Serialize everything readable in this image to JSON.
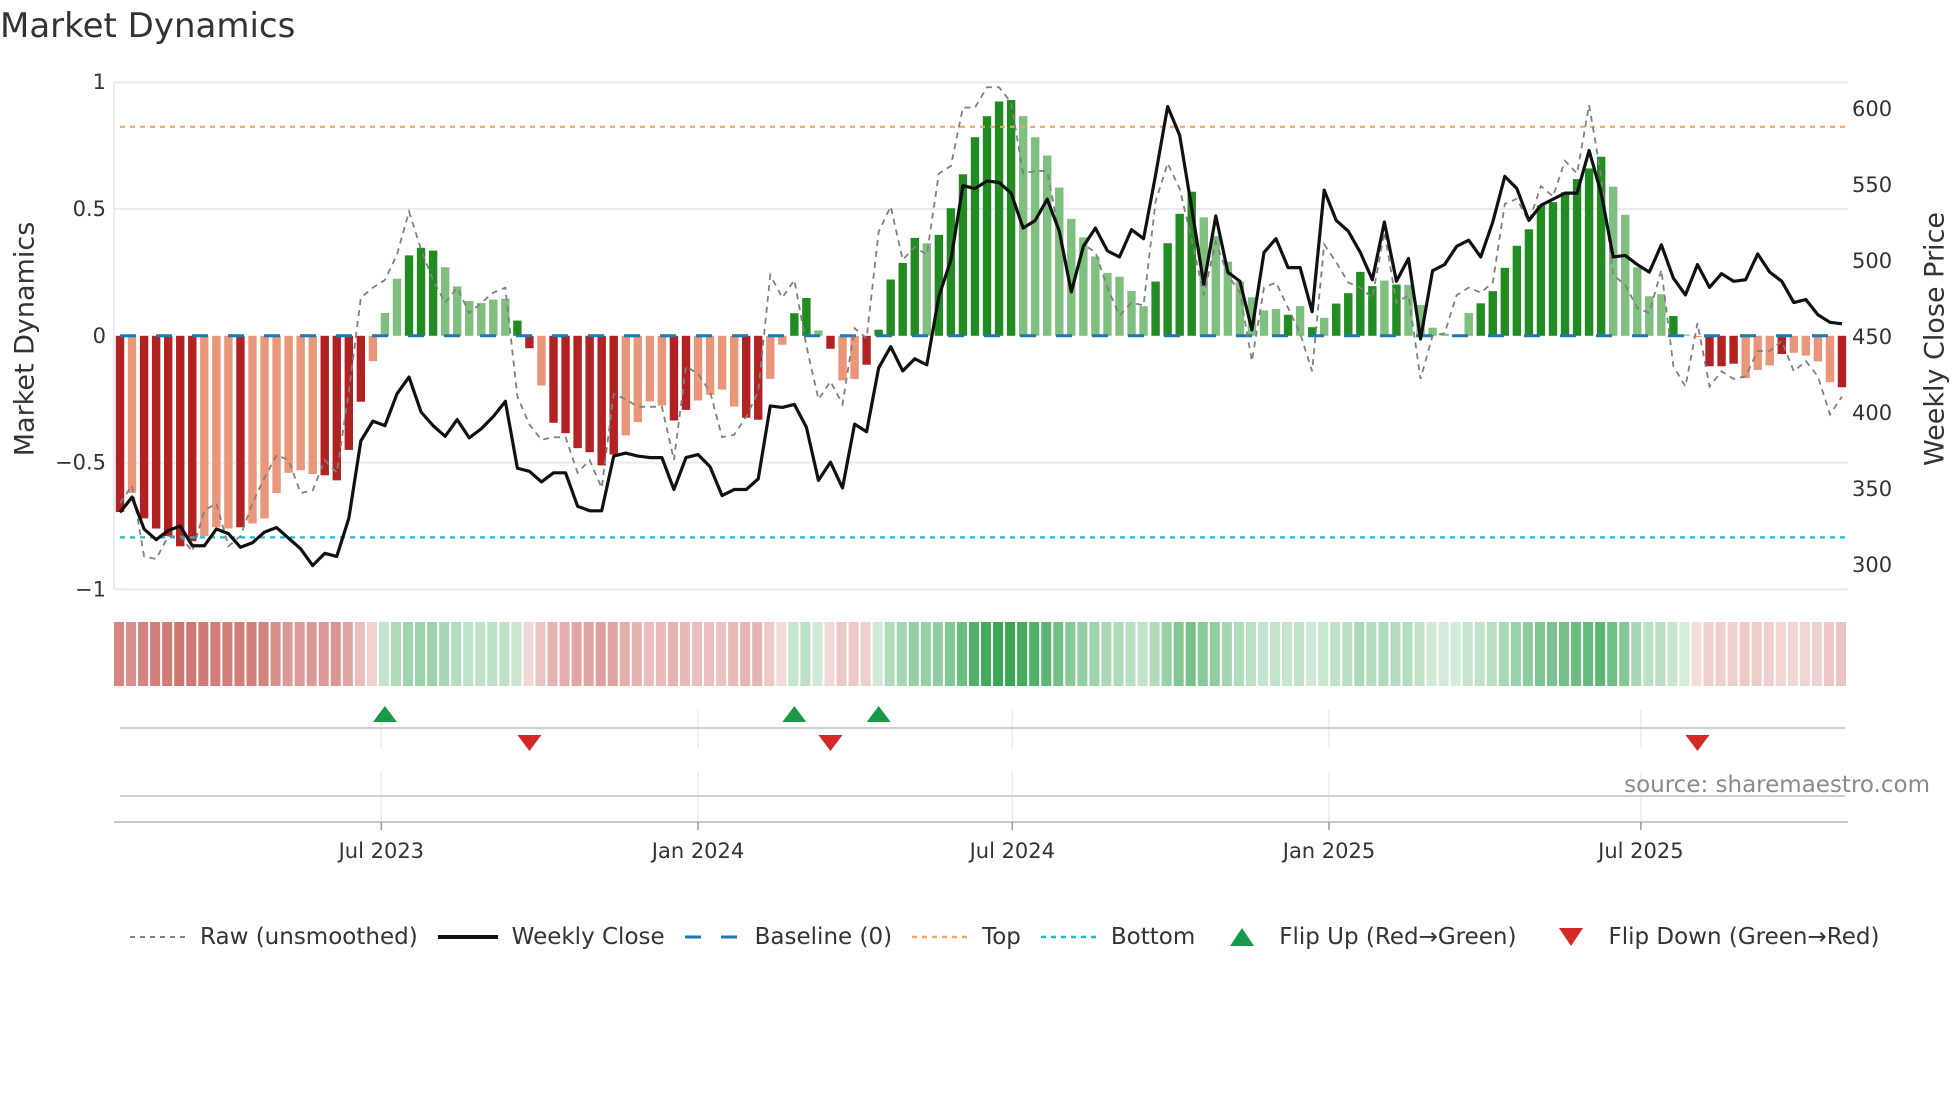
{
  "title": "Market Dynamics",
  "source": "source: sharemaestro.com",
  "legend": {
    "raw": "Raw (unsmoothed)",
    "close": "Weekly Close",
    "baseline": "Baseline (0)",
    "top": "Top",
    "bottom": "Bottom",
    "flip_up": "Flip Up (Red→Green)",
    "flip_down": "Flip Down (Green→Red)"
  },
  "colors": {
    "bar_neg_strong": "#b22222",
    "bar_neg_weak": "#e9967a",
    "bar_pos_strong": "#228b22",
    "bar_pos_weak": "#7fbf7f",
    "raw": "#808080",
    "close": "#111111",
    "baseline": "#1f77b4",
    "top": "#f0a868",
    "bottom": "#17becf",
    "flip_up": "#1a9a48",
    "flip_down": "#d62728"
  },
  "chart_data": {
    "type": "bar",
    "title": "Market Dynamics",
    "ylabel": "Market Dynamics",
    "y2label": "Weekly Close Price",
    "ylim": [
      -1,
      1
    ],
    "y2lim": [
      300,
      600
    ],
    "yticks": [
      "1",
      "0.5",
      "0",
      "−0.5",
      "−1"
    ],
    "ytick_values": [
      1,
      0.5,
      0,
      -0.5,
      -1
    ],
    "y2ticks": [
      "600",
      "550",
      "500",
      "450",
      "400",
      "350",
      "300"
    ],
    "y2tick_values": [
      600,
      550,
      500,
      450,
      400,
      350,
      300
    ],
    "x_unit": "week index (weekly bars, Feb 2023 to Oct 2025)",
    "xticks": [
      {
        "label": "Jul 2023",
        "week": 21.7
      },
      {
        "label": "Jan 2024",
        "week": 48.0
      },
      {
        "label": "Jul 2024",
        "week": 74.1
      },
      {
        "label": "Jan 2025",
        "week": 100.4
      },
      {
        "label": "Jul 2025",
        "week": 126.3
      }
    ],
    "top_level": 0.824,
    "bottom_level": -0.795,
    "baseline": 0,
    "dynamics": [
      -0.695,
      -0.62,
      -0.72,
      -0.76,
      -0.79,
      -0.83,
      -0.81,
      -0.79,
      -0.755,
      -0.76,
      -0.755,
      -0.74,
      -0.72,
      -0.62,
      -0.54,
      -0.53,
      -0.545,
      -0.55,
      -0.57,
      -0.45,
      -0.26,
      -0.1,
      0.09,
      0.225,
      0.317,
      0.347,
      0.336,
      0.27,
      0.195,
      0.137,
      0.129,
      0.143,
      0.146,
      0.06,
      -0.049,
      -0.196,
      -0.343,
      -0.384,
      -0.443,
      -0.459,
      -0.511,
      -0.468,
      -0.393,
      -0.34,
      -0.259,
      -0.275,
      -0.334,
      -0.292,
      -0.255,
      -0.233,
      -0.212,
      -0.279,
      -0.323,
      -0.331,
      -0.17,
      -0.035,
      0.089,
      0.149,
      0.021,
      -0.051,
      -0.176,
      -0.17,
      -0.114,
      0.024,
      0.222,
      0.287,
      0.386,
      0.365,
      0.398,
      0.503,
      0.637,
      0.783,
      0.866,
      0.924,
      0.93,
      0.866,
      0.783,
      0.711,
      0.585,
      0.461,
      0.388,
      0.313,
      0.248,
      0.233,
      0.177,
      0.117,
      0.214,
      0.365,
      0.481,
      0.568,
      0.467,
      0.393,
      0.292,
      0.214,
      0.152,
      0.1,
      0.106,
      0.083,
      0.117,
      0.034,
      0.071,
      0.127,
      0.168,
      0.252,
      0.196,
      0.218,
      0.202,
      0.201,
      0.122,
      0.032,
      0.008,
      0.003,
      0.09,
      0.128,
      0.176,
      0.268,
      0.355,
      0.42,
      0.514,
      0.527,
      0.566,
      0.618,
      0.66,
      0.706,
      0.588,
      0.477,
      0.27,
      0.156,
      0.164,
      0.078,
      0.005,
      -0.005,
      -0.12,
      -0.12,
      -0.11,
      -0.167,
      -0.135,
      -0.117,
      -0.072,
      -0.067,
      -0.078,
      -0.101,
      -0.183,
      -0.203
    ],
    "shade": "dldddddllldllllllddddllldddllllllddlddddddllllddllllddllddldlldddddldddddddlllllllllllddddllllllldldlddddldlllllldddddddddddllllldlldddllldlllldddd",
    "raw": [
      -0.66,
      -0.59,
      -0.87,
      -0.88,
      -0.79,
      -0.79,
      -0.85,
      -0.69,
      -0.66,
      -0.83,
      -0.79,
      -0.66,
      -0.56,
      -0.47,
      -0.49,
      -0.62,
      -0.61,
      -0.49,
      -0.54,
      -0.22,
      0.15,
      0.19,
      0.22,
      0.32,
      0.49,
      0.34,
      0.22,
      0.13,
      0.19,
      0.09,
      0.13,
      0.17,
      0.19,
      -0.24,
      -0.35,
      -0.41,
      -0.4,
      -0.4,
      -0.54,
      -0.49,
      -0.6,
      -0.23,
      -0.25,
      -0.28,
      -0.28,
      -0.28,
      -0.49,
      -0.12,
      -0.15,
      -0.22,
      -0.4,
      -0.39,
      -0.32,
      -0.22,
      0.24,
      0.15,
      0.22,
      -0.04,
      -0.25,
      -0.18,
      -0.27,
      0.03,
      -0.01,
      0.41,
      0.51,
      0.3,
      0.35,
      0.32,
      0.64,
      0.67,
      0.9,
      0.9,
      0.98,
      0.98,
      0.92,
      0.64,
      0.65,
      0.65,
      0.4,
      0.17,
      0.36,
      0.33,
      0.19,
      0.08,
      0.13,
      0.12,
      0.53,
      0.68,
      0.58,
      0.38,
      0.16,
      0.37,
      0.24,
      0.17,
      -0.1,
      0.19,
      0.21,
      0.11,
      0.01,
      -0.14,
      0.36,
      0.29,
      0.21,
      0.19,
      0.15,
      0.41,
      0.13,
      0.16,
      -0.17,
      0.0,
      0.01,
      0.16,
      0.19,
      0.17,
      0.21,
      0.52,
      0.54,
      0.45,
      0.59,
      0.55,
      0.69,
      0.64,
      0.91,
      0.63,
      0.24,
      0.2,
      0.11,
      0.09,
      0.26,
      -0.12,
      -0.2,
      0.05,
      -0.2,
      -0.14,
      -0.17,
      -0.16,
      -0.06,
      -0.06,
      -0.02,
      -0.14,
      -0.1,
      -0.16,
      -0.31,
      -0.24
    ],
    "close": [
      334,
      344,
      323,
      316,
      322,
      325,
      312,
      312,
      323,
      320,
      311,
      314,
      321,
      324,
      317,
      310,
      299,
      307,
      305,
      330,
      381,
      394,
      391,
      412,
      423,
      400,
      391,
      384,
      395,
      383,
      389,
      397,
      407,
      363,
      361,
      354,
      360,
      360,
      338,
      335,
      335,
      371,
      373,
      371,
      370,
      370,
      349,
      370,
      372,
      364,
      345,
      349,
      349,
      356,
      404,
      403,
      405,
      390,
      355,
      367,
      350,
      392,
      387,
      429,
      443,
      427,
      435,
      431,
      476,
      500,
      549,
      547,
      552,
      551,
      544,
      521,
      526,
      540,
      519,
      479,
      509,
      521,
      506,
      502,
      520,
      514,
      556,
      601,
      582,
      534,
      484,
      529,
      492,
      486,
      454,
      505,
      514,
      495,
      495,
      466,
      546,
      526,
      519,
      505,
      487,
      525,
      486,
      501,
      448,
      493,
      497,
      509,
      513,
      502,
      525,
      555,
      547,
      526,
      536,
      540,
      544,
      544,
      572,
      544,
      502,
      503,
      497,
      492,
      510,
      488,
      477,
      497,
      482,
      491,
      486,
      487,
      504,
      492,
      486,
      472,
      474,
      464,
      459,
      458
    ],
    "flips_up": [
      22,
      56,
      63
    ],
    "flips_down": [
      34,
      59,
      131
    ]
  }
}
